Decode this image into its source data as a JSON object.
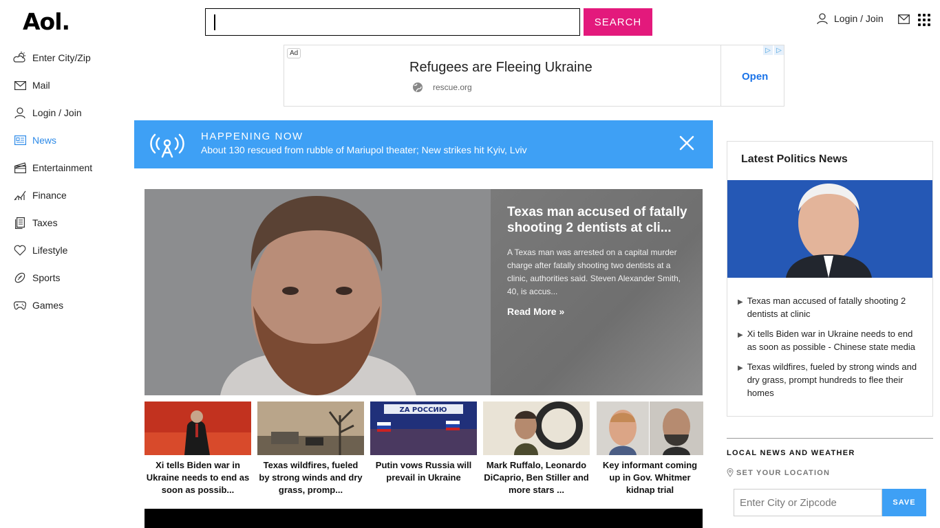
{
  "header": {
    "logo": "Aol.",
    "search_button": "SEARCH",
    "login_label": "Login / Join"
  },
  "sidebar": {
    "items": [
      {
        "label": "Enter City/Zip",
        "icon": "weather-icon"
      },
      {
        "label": "Mail",
        "icon": "mail-icon"
      },
      {
        "label": "Login / Join",
        "icon": "user-icon"
      },
      {
        "label": "News",
        "icon": "news-icon",
        "active": true
      },
      {
        "label": "Entertainment",
        "icon": "clapper-icon"
      },
      {
        "label": "Finance",
        "icon": "chart-icon"
      },
      {
        "label": "Taxes",
        "icon": "document-icon"
      },
      {
        "label": "Lifestyle",
        "icon": "heart-icon"
      },
      {
        "label": "Sports",
        "icon": "football-icon"
      },
      {
        "label": "Games",
        "icon": "gamepad-icon"
      }
    ]
  },
  "ad": {
    "tag": "Ad",
    "title": "Refugees are Fleeing Ukraine",
    "url": "rescue.org",
    "cta": "Open"
  },
  "happening": {
    "label": "HAPPENING NOW",
    "text": "About 130 rescued from rubble of Mariupol theater; New strikes hit Kyiv, Lviv"
  },
  "hero": {
    "title": "Texas man accused of fatally shooting 2 dentists at cli...",
    "summary": "A Texas man was arrested on a capital murder charge after fatally shooting two dentists at a clinic, authorities said. Steven Alexander Smith, 40, is accus...",
    "read_more": "Read More »"
  },
  "thumbs": [
    {
      "caption": "Xi tells Biden war in Ukraine needs to end as soon as possib..."
    },
    {
      "caption": "Texas wildfires, fueled by strong winds and dry grass, promp..."
    },
    {
      "caption": "Putin vows Russia will prevail in Ukraine",
      "image_text": "ZA РОССИЮ"
    },
    {
      "caption": "Mark Ruffalo, Leonardo DiCaprio, Ben Stiller and more stars ..."
    },
    {
      "caption": "Key informant coming up in Gov. Whitmer kidnap trial"
    }
  ],
  "politics": {
    "title": "Latest Politics News",
    "items": [
      "Texas man accused of fatally shooting 2 dentists at clinic",
      "Xi tells Biden war in Ukraine needs to end as soon as possible - Chinese state media",
      "Texas wildfires, fueled by strong winds and dry grass, prompt hundreds to flee their homes"
    ]
  },
  "local": {
    "title": "LOCAL NEWS AND WEATHER",
    "set_location": "SET YOUR LOCATION",
    "placeholder": "Enter City or Zipcode",
    "save": "SAVE"
  },
  "colors": {
    "accent_pink": "#e3197c",
    "accent_blue": "#3ea0f5",
    "active_nav": "#2d8ae8"
  }
}
